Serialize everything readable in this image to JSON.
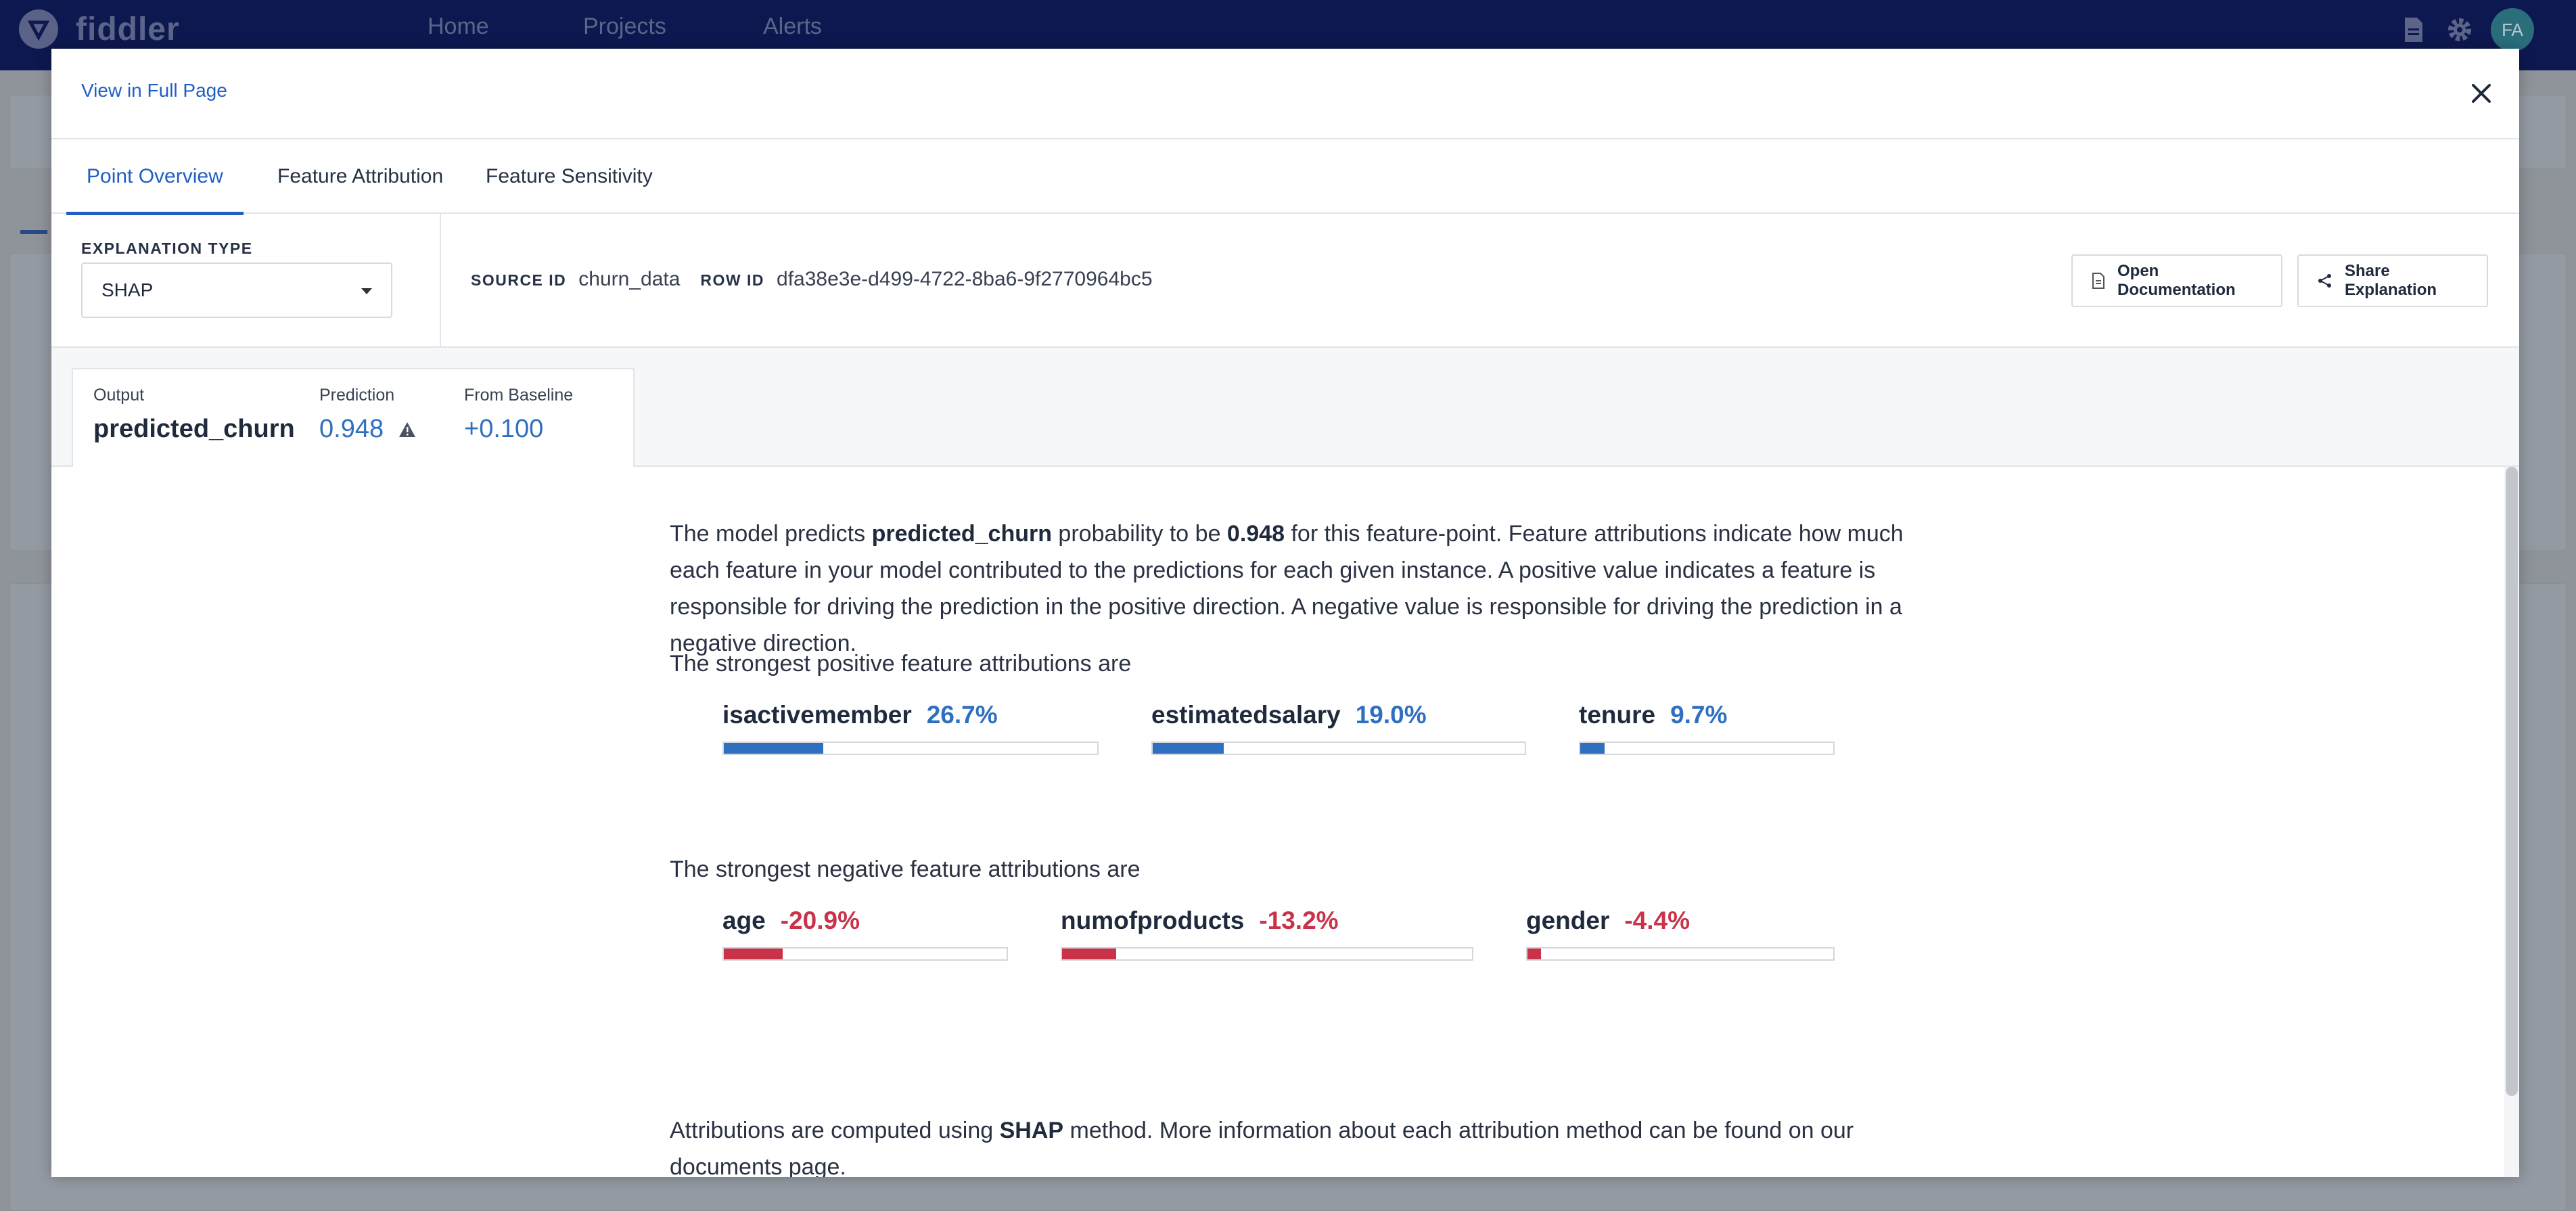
{
  "nav": {
    "brand": "fiddler",
    "links": [
      "Home",
      "Projects",
      "Alerts"
    ],
    "avatar_initials": "FA"
  },
  "modal": {
    "full_page_link": "View in Full Page",
    "tabs": [
      {
        "label": "Point Overview",
        "active": true
      },
      {
        "label": "Feature Attribution",
        "active": false
      },
      {
        "label": "Feature Sensitivity",
        "active": false
      }
    ],
    "explanation_type": {
      "label": "EXPLANATION TYPE",
      "value": "SHAP"
    },
    "source": {
      "source_id_label": "SOURCE ID",
      "source_id": "churn_data",
      "row_id_label": "ROW ID",
      "row_id": "dfa38e3e-d499-4722-8ba6-9f2770964bc5"
    },
    "buttons": {
      "open_documentation": "Open Documentation",
      "share_explanation": "Share Explanation"
    },
    "output": {
      "output_label": "Output",
      "output_value": "predicted_churn",
      "prediction_label": "Prediction",
      "prediction_value": "0.948",
      "baseline_label": "From Baseline",
      "baseline_value": "+0.100"
    },
    "summary": {
      "p1_a": "The model predicts ",
      "p1_target": "predicted_churn",
      "p1_b": " probability to be ",
      "p1_value": "0.948",
      "p1_c": " for this feature-point. Feature attributions indicate how much each feature in your model contributed to the predictions for each given instance. A positive value indicates a feature is responsible for driving the prediction in the positive direction. A negative value is responsible for driving the prediction in a negative direction.",
      "positive_heading": "The strongest positive feature attributions are",
      "negative_heading": "The strongest negative feature attributions are",
      "footer_a": "Attributions are computed using ",
      "footer_method": "SHAP",
      "footer_b": " method. More information about each attribution method can be found on our documents page."
    },
    "positive_attributions": [
      {
        "name": "isactivemember",
        "pct": "26.7%",
        "value": 0.267
      },
      {
        "name": "estimatedsalary",
        "pct": "19.0%",
        "value": 0.19
      },
      {
        "name": "tenure",
        "pct": "9.7%",
        "value": 0.097
      }
    ],
    "negative_attributions": [
      {
        "name": "age",
        "pct": "-20.9%",
        "value": 0.209
      },
      {
        "name": "numofproducts",
        "pct": "-13.2%",
        "value": 0.132
      },
      {
        "name": "gender",
        "pct": "-4.4%",
        "value": 0.044
      }
    ]
  }
}
